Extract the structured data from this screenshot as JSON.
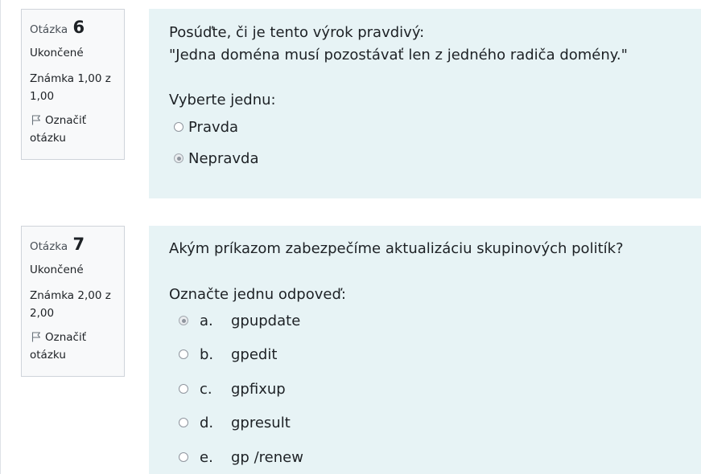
{
  "questions": [
    {
      "label": "Otázka",
      "number": "6",
      "state": "Ukončené",
      "grade": "Známka 1,00 z 1,00",
      "flag_label": "Označiť otázku",
      "text_line1": "Posúďte, či je tento výrok pravdivý:",
      "text_line2": "\"Jedna doména musí pozostávať len z jedného radiča domény.\"",
      "prompt": "Vyberte jednu:",
      "options": [
        {
          "letter": "",
          "label": "Pravda",
          "checked": false
        },
        {
          "letter": "",
          "label": "Nepravda",
          "checked": true
        }
      ]
    },
    {
      "label": "Otázka",
      "number": "7",
      "state": "Ukončené",
      "grade": "Známka 2,00 z 2,00",
      "flag_label": "Označiť otázku",
      "text_line1": "Akým príkazom zabezpečíme aktualizáciu skupinových politík?",
      "prompt": "Označte jednu odpoveď:",
      "options": [
        {
          "letter": "a.",
          "label": "gpupdate",
          "checked": true
        },
        {
          "letter": "b.",
          "label": "gpedit",
          "checked": false
        },
        {
          "letter": "c.",
          "label": "gpfixup",
          "checked": false
        },
        {
          "letter": "d.",
          "label": "gpresult",
          "checked": false
        },
        {
          "letter": "e.",
          "label": "gp /renew",
          "checked": false
        }
      ]
    }
  ],
  "colors": {
    "info_bg": "#f8f9fa",
    "info_border": "#cfd4da",
    "content_bg": "#e7f3f5",
    "text": "#1d2125"
  }
}
